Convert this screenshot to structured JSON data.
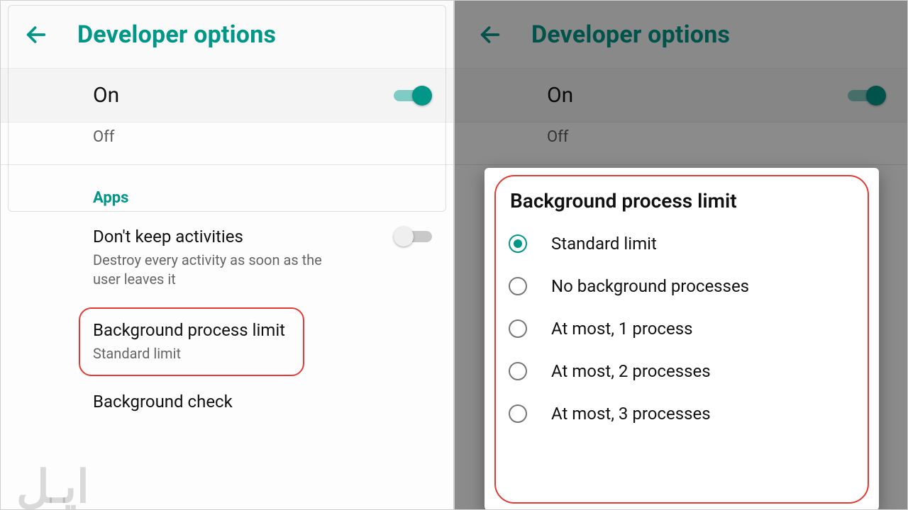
{
  "accent": "#009688",
  "highlight": "#e53935",
  "appbar": {
    "title": "Developer options"
  },
  "master": {
    "label": "On",
    "enabled": true
  },
  "sub_off": "Off",
  "section": {
    "apps": "Apps"
  },
  "settings": {
    "dont_keep": {
      "title": "Don't keep activities",
      "subtitle": "Destroy every activity as soon as the user leaves it",
      "enabled": false
    },
    "bg_limit": {
      "title": "Background process limit",
      "value": "Standard limit"
    },
    "bg_check": {
      "title": "Background check"
    }
  },
  "dialog": {
    "title": "Background process limit",
    "selected_index": 0,
    "options": [
      "Standard limit",
      "No background processes",
      "At most, 1 process",
      "At most, 2 processes",
      "At most, 3 processes"
    ]
  },
  "watermark": "ايـل"
}
